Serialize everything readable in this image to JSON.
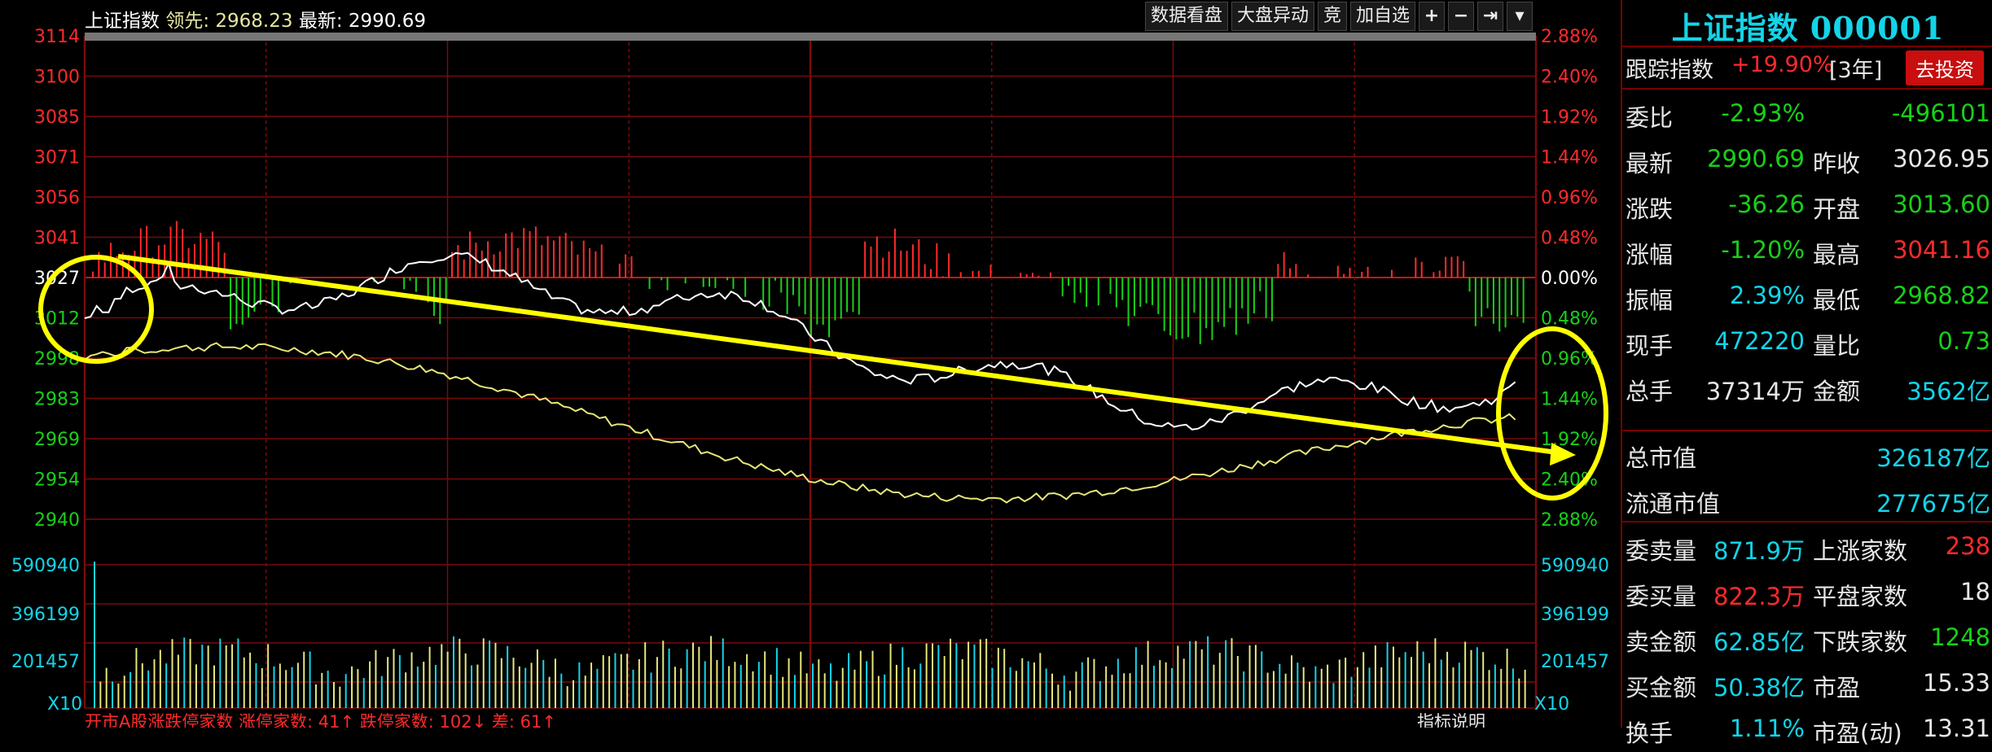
{
  "topbar": {
    "index_name": "上证指数",
    "lead_label": "领先:",
    "lead_value": "2968.23",
    "latest_label": "最新:",
    "latest_value": "2990.69",
    "buttons": [
      "数据看盘",
      "大盘异动",
      "竞",
      "加自选"
    ],
    "icon_buttons": [
      "plus-icon",
      "minus-icon",
      "pin-right-icon",
      "dropdown-icon"
    ]
  },
  "price_axis": {
    "left_labels": [
      "3114",
      "3100",
      "3085",
      "3071",
      "3056",
      "3041",
      "3027",
      "3012",
      "2998",
      "2983",
      "2969",
      "2954",
      "2940"
    ],
    "right_labels": [
      "2.88%",
      "2.40%",
      "1.92%",
      "1.44%",
      "0.96%",
      "0.48%",
      "0.00%",
      "0.48%",
      "0.96%",
      "1.44%",
      "1.92%",
      "2.40%",
      "2.88%"
    ],
    "up_color": "#ff2a2a",
    "down_color": "#18d018",
    "neutral_color": "#ffffff"
  },
  "volume_axis": {
    "labels": [
      "590940",
      "396199",
      "201457"
    ],
    "multiplier": "X10"
  },
  "bottom_status": {
    "left_text": "开市A股涨跌停家数 涨停家数: 41↑ 跌停家数: 102↓ 差: 61↑",
    "right_text": "指标说明"
  },
  "panel": {
    "title": "上证指数 000001",
    "track_label": "跟踪指数",
    "track_change": "+19.90%",
    "track_period": "[3年]",
    "invest_button": "去投资",
    "rows": [
      {
        "l1": "委比",
        "v1": "-2.93%",
        "c1": "#18d018",
        "l2": "",
        "v2": "-496101",
        "c2": "#18d018"
      },
      {
        "l1": "最新",
        "v1": "2990.69",
        "c1": "#18d018",
        "l2": "昨收",
        "v2": "3026.95",
        "c2": "#e6e6e6"
      },
      {
        "l1": "涨跌",
        "v1": "-36.26",
        "c1": "#18d018",
        "l2": "开盘",
        "v2": "3013.60",
        "c2": "#18d018"
      },
      {
        "l1": "涨幅",
        "v1": "-1.20%",
        "c1": "#18d018",
        "l2": "最高",
        "v2": "3041.16",
        "c2": "#ff2a2a"
      },
      {
        "l1": "振幅",
        "v1": "2.39%",
        "c1": "#13d4e8",
        "l2": "最低",
        "v2": "2968.82",
        "c2": "#18d018"
      },
      {
        "l1": "现手",
        "v1": "472220",
        "c1": "#13d4e8",
        "l2": "量比",
        "v2": "0.73",
        "c2": "#18d018"
      },
      {
        "l1": "总手",
        "v1": "37314万",
        "c1": "#e6e6e6",
        "l2": "金额",
        "v2": "3562亿",
        "c2": "#13d4e8"
      }
    ],
    "market_cap_label": "总市值",
    "market_cap_value": "326187亿",
    "float_cap_label": "流通市值",
    "float_cap_value": "277675亿",
    "orders": [
      {
        "l1": "委卖量",
        "v1": "871.9万",
        "c1": "#13d4e8",
        "l2": "上涨家数",
        "v2": "238",
        "c2": "#ff2a2a"
      },
      {
        "l1": "委买量",
        "v1": "822.3万",
        "c1": "#ff2a2a",
        "l2": "平盘家数",
        "v2": "18",
        "c2": "#e6e6e6"
      },
      {
        "l1": "卖金额",
        "v1": "62.85亿",
        "c1": "#13d4e8",
        "l2": "下跌家数",
        "v2": "1248",
        "c2": "#18d018"
      },
      {
        "l1": "买金额",
        "v1": "50.38亿",
        "c1": "#13d4e8",
        "l2": "市盈",
        "v2": "15.33",
        "c2": "#e6e6e6"
      },
      {
        "l1": "换手",
        "v1": "1.11%",
        "c1": "#13d4e8",
        "l2": "市盈(动)",
        "v2": "13.31",
        "c2": "#e6e6e6"
      }
    ]
  }
}
